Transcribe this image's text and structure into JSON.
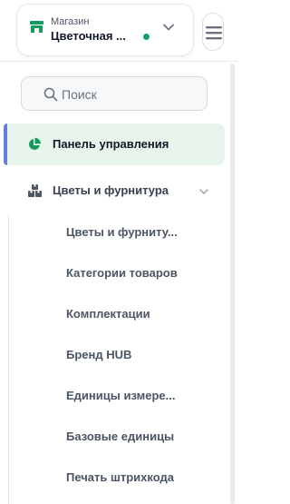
{
  "store": {
    "label": "Магазин",
    "name": "Цветочная ...",
    "status_color": "#10a36b",
    "icon": "storefront-icon"
  },
  "search": {
    "placeholder": "Поиск",
    "icon": "search-icon"
  },
  "colors": {
    "accent_green": "#159a5e",
    "active_bg": "#e6f4ec",
    "active_bar": "#6a7dd9"
  },
  "nav": {
    "dashboard": {
      "label": "Панель управления",
      "icon": "pie-chart-icon",
      "active": true
    },
    "group": {
      "label": "Цветы и фурнитура",
      "icon": "boxes-icon",
      "expanded": true,
      "items": [
        {
          "label": "Цветы и фурниту..."
        },
        {
          "label": "Категории товаров"
        },
        {
          "label": "Комплектации"
        },
        {
          "label": "Бренд HUB"
        },
        {
          "label": "Единицы измере..."
        },
        {
          "label": "Базовые единицы"
        },
        {
          "label": "Печать штрихкода"
        }
      ]
    }
  }
}
